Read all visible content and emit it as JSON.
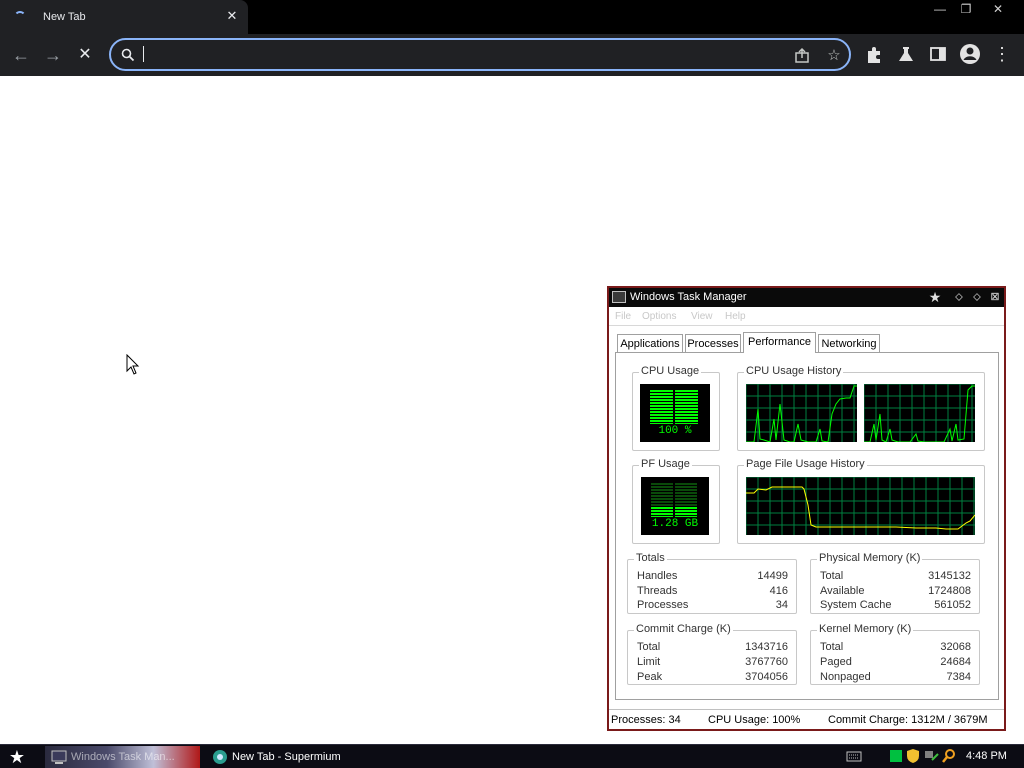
{
  "browser": {
    "tab_title": "New Tab",
    "window_controls": {
      "minimize": "—",
      "restore": "❐",
      "close": "✕"
    },
    "nav": {
      "back": "←",
      "forward": "→",
      "stop": "✕"
    },
    "omnibox": {
      "value": "",
      "placeholder": ""
    }
  },
  "task_manager": {
    "title": "Windows Task Manager",
    "menu": [
      "File",
      "Options",
      "View",
      "Help"
    ],
    "tabs": [
      "Applications",
      "Processes",
      "Performance",
      "Networking"
    ],
    "active_tab": "Performance",
    "cpu_usage": {
      "label": "CPU Usage",
      "value": "100 %",
      "percent": 100
    },
    "cpu_history": {
      "label": "CPU Usage History"
    },
    "pf_usage": {
      "label": "PF Usage",
      "value": "1.28 GB",
      "percent": 40
    },
    "pf_history": {
      "label": "Page File Usage History"
    },
    "totals": {
      "label": "Totals",
      "rows": [
        {
          "k": "Handles",
          "v": "14499"
        },
        {
          "k": "Threads",
          "v": "416"
        },
        {
          "k": "Processes",
          "v": "34"
        }
      ]
    },
    "physical_memory": {
      "label": "Physical Memory (K)",
      "rows": [
        {
          "k": "Total",
          "v": "3145132"
        },
        {
          "k": "Available",
          "v": "1724808"
        },
        {
          "k": "System Cache",
          "v": "561052"
        }
      ]
    },
    "commit_charge": {
      "label": "Commit Charge (K)",
      "rows": [
        {
          "k": "Total",
          "v": "1343716"
        },
        {
          "k": "Limit",
          "v": "3767760"
        },
        {
          "k": "Peak",
          "v": "3704056"
        }
      ]
    },
    "kernel_memory": {
      "label": "Kernel Memory (K)",
      "rows": [
        {
          "k": "Total",
          "v": "32068"
        },
        {
          "k": "Paged",
          "v": "24684"
        },
        {
          "k": "Nonpaged",
          "v": "7384"
        }
      ]
    },
    "status": {
      "processes": "Processes: 34",
      "cpu": "CPU Usage: 100%",
      "commit": "Commit Charge: 1312M / 3679M"
    }
  },
  "taskbar": {
    "items": [
      {
        "label": "Windows Task Man..."
      },
      {
        "label": "New Tab - Supermium"
      }
    ],
    "clock": "4:48 PM"
  },
  "colors": {
    "accent": "#8ab4f8",
    "graph_green": "#00ff00",
    "graph_grid": "#008040",
    "pf_line": "#ffff00",
    "tm_border": "#7a1a1a"
  }
}
